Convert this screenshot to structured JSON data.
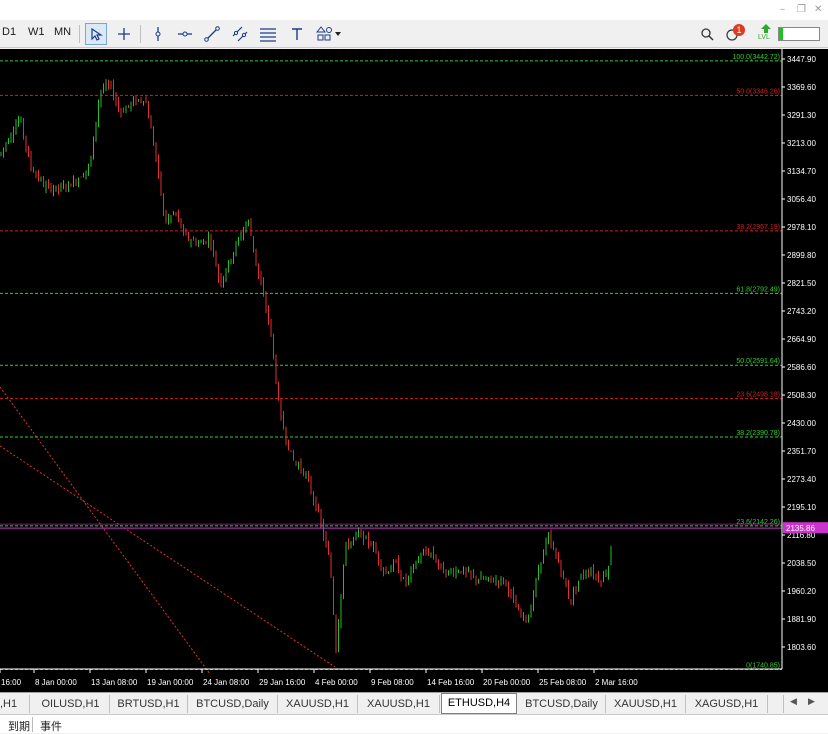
{
  "toolbar": {
    "timeframes": [
      "D1",
      "W1",
      "MN"
    ],
    "notification_count": "1",
    "lvl_label": "LVL"
  },
  "chart": {
    "symbol": "ETHUSD",
    "timeframe": "H4",
    "current_price": "2135.86",
    "price_ticks": [
      "3447.90",
      "3369.60",
      "3291.30",
      "3213.00",
      "3134.70",
      "3056.40",
      "2978.10",
      "2899.80",
      "2821.50",
      "2743.20",
      "2664.90",
      "2586.60",
      "2508.30",
      "2430.00",
      "2351.70",
      "2273.40",
      "2195.10",
      "2116.80",
      "2038.50",
      "1960.20",
      "1881.90",
      "1803.60"
    ],
    "time_ticks": [
      "16:00",
      "8 Jan 00:00",
      "13 Jan 08:00",
      "19 Jan 00:00",
      "24 Jan 08:00",
      "29 Jan 16:00",
      "4 Feb 00:00",
      "9 Feb 08:00",
      "14 Feb 16:00",
      "20 Feb 00:00",
      "25 Feb 08:00",
      "2 Mar 16:00"
    ],
    "fib_levels": [
      {
        "label": "100.0(3442.72)",
        "color": "#33cc33"
      },
      {
        "label": "50.0(3346.26)",
        "color": "#cc2222"
      },
      {
        "label": "38.2(2967.19)",
        "color": "#cc2222"
      },
      {
        "label": "61.8(2792.49)",
        "color": "#33cc33"
      },
      {
        "label": "50.0(2591.64)",
        "color": "#33cc33"
      },
      {
        "label": "23.6(2498.18)",
        "color": "#cc2222"
      },
      {
        "label": "38.2(2390.78)",
        "color": "#33cc33"
      },
      {
        "label": "23.6(2142.26)",
        "color": "#33cc33"
      },
      {
        "label": "0(1740.85)",
        "color": "#33cc33"
      }
    ],
    "colors": {
      "bull": "#22c022",
      "bear": "#e03030",
      "background": "#000000",
      "axis": "#ffffff",
      "price_line": "#cc33cc"
    }
  },
  "tabs": [
    "OILUSD,H1",
    "BRTUSD,H1",
    "BTCUSD,Daily",
    "XAUUSD,H1",
    "XAUUSD,H1",
    "ETHUSD,H4",
    "BTCUSD,Daily",
    "XAUUSD,H1",
    "XAGUSD,H1"
  ],
  "tab_partial_left": ",H1",
  "bottom_tabs": [
    "到期",
    "事件"
  ]
}
